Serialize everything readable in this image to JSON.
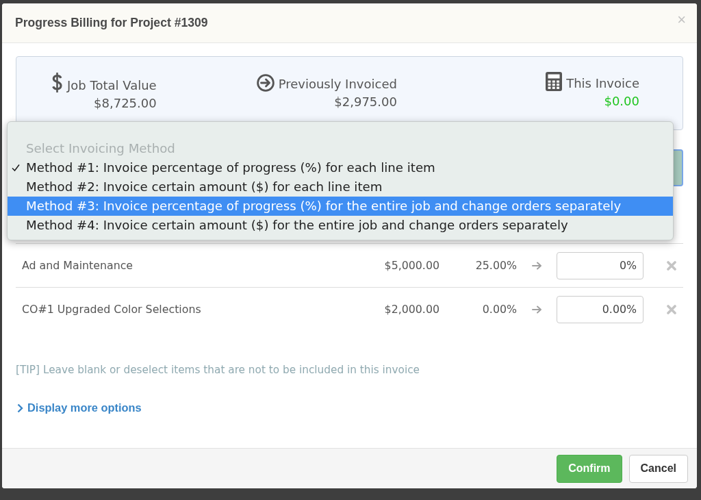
{
  "dialog": {
    "title": "Progress Billing for Project #1309",
    "close": "×"
  },
  "summary": [
    {
      "kind": "dollar",
      "label": "Job Total Value",
      "value": "$8,725.00",
      "color": "#555555"
    },
    {
      "kind": "arrow",
      "label": "Previously Invoiced",
      "value": "$2,975.00",
      "color": "#555555"
    },
    {
      "kind": "calculator",
      "label": "This Invoice",
      "value": "$0.00",
      "color": "#1ec41e"
    }
  ],
  "method_select": {
    "heading": "Select Invoicing Method",
    "expanded": true,
    "options": [
      {
        "label": "Method #1: Invoice percentage of progress (%) for each line item",
        "selected": true,
        "highlighted": false
      },
      {
        "label": "Method #2: Invoice certain amount ($) for each line item",
        "selected": false,
        "highlighted": false
      },
      {
        "label": "Method #3: Invoice percentage of progress (%) for the entire job and change orders separately",
        "selected": false,
        "highlighted": true
      },
      {
        "label": "Method #4: Invoice certain amount ($) for the entire job and change orders separately",
        "selected": false,
        "highlighted": false
      }
    ]
  },
  "line_items": [
    {
      "description": "Ad and Maintenance",
      "amount": "$5,000.00",
      "progress": "25.00%",
      "value": "0%"
    },
    {
      "description": "CO#1 Upgraded Color Selections",
      "amount": "$2,000.00",
      "progress": "0.00%",
      "value": "0.00%"
    }
  ],
  "tip": "[TIP] Leave blank or deselect items that are not to be included in this invoice",
  "more_options": {
    "label": "Display more options",
    "expanded": false
  },
  "buttons": [
    {
      "kind": "primary",
      "label": "Confirm"
    },
    {
      "kind": "default",
      "label": "Cancel"
    }
  ]
}
